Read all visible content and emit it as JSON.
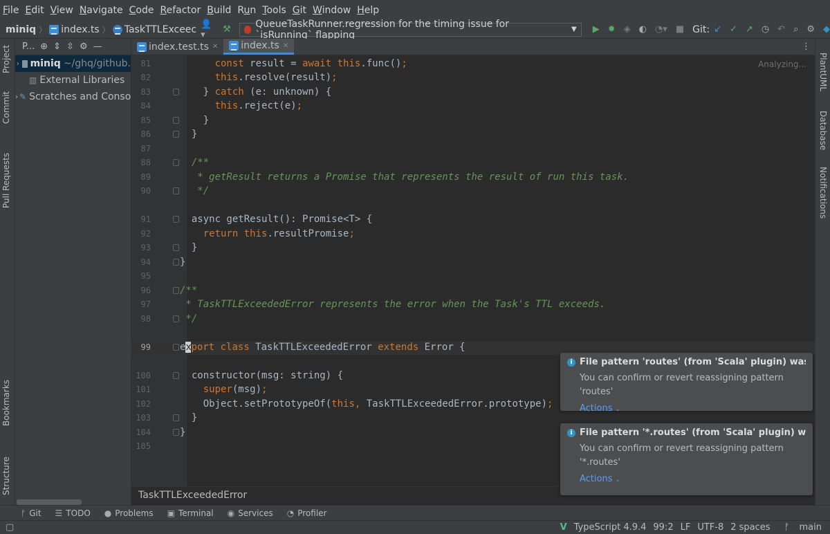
{
  "menu": [
    "File",
    "Edit",
    "View",
    "Navigate",
    "Code",
    "Refactor",
    "Build",
    "Run",
    "Tools",
    "Git",
    "Window",
    "Help"
  ],
  "menu_mnemonic_index": [
    0,
    0,
    0,
    0,
    0,
    0,
    0,
    1,
    0,
    0,
    0,
    0
  ],
  "breadcrumbs": [
    "miniq",
    "index.ts",
    "TaskTTLExceec"
  ],
  "run_config": "QueueTaskRunner.regression for the timing issue for `isRunning` flapping",
  "git_label": "Git:",
  "project_panel": {
    "title": "P...",
    "items": [
      {
        "label": "miniq",
        "path": "~/ghq/github."
      },
      {
        "label": "External Libraries"
      },
      {
        "label": "Scratches and Conso"
      }
    ]
  },
  "left_tabs": [
    "Project",
    "Commit",
    "Pull Requests",
    "Bookmarks",
    "Structure"
  ],
  "right_tabs": [
    "PlantUML",
    "Database",
    "Notifications"
  ],
  "editor_tabs": [
    {
      "label": "index.test.ts",
      "active": false
    },
    {
      "label": "index.ts",
      "active": true
    }
  ],
  "analyzing": "Analyzing...",
  "code_lines": [
    {
      "n": "81",
      "parts": [
        [
          "tx",
          "      "
        ],
        [
          "kw",
          "const "
        ],
        [
          "tx",
          "result = "
        ],
        [
          "kw",
          "await this"
        ],
        [
          "tx",
          ".func()"
        ],
        [
          "kw",
          ";"
        ]
      ]
    },
    {
      "n": "82",
      "parts": [
        [
          "tx",
          "      "
        ],
        [
          "kw",
          "this"
        ],
        [
          "tx",
          ".resolve(result)"
        ],
        [
          "kw",
          ";"
        ]
      ]
    },
    {
      "n": "83",
      "parts": [
        [
          "tx",
          "    } "
        ],
        [
          "kw",
          "catch "
        ],
        [
          "tx",
          "(e: unknown) {"
        ]
      ]
    },
    {
      "n": "84",
      "parts": [
        [
          "tx",
          "      "
        ],
        [
          "kw",
          "this"
        ],
        [
          "tx",
          ".reject(e)"
        ],
        [
          "kw",
          ";"
        ]
      ]
    },
    {
      "n": "85",
      "parts": [
        [
          "tx",
          "    }"
        ]
      ]
    },
    {
      "n": "86",
      "parts": [
        [
          "tx",
          "  }"
        ]
      ]
    },
    {
      "n": "87",
      "parts": []
    },
    {
      "n": "88",
      "parts": [
        [
          "cm",
          "  /**"
        ]
      ]
    },
    {
      "n": "89",
      "parts": [
        [
          "cm",
          "   * getResult returns a Promise that represents the result of run this task."
        ]
      ]
    },
    {
      "n": "90",
      "parts": [
        [
          "cm",
          "   */"
        ]
      ]
    },
    {
      "n": "",
      "parts": []
    },
    {
      "n": "91",
      "parts": [
        [
          "tx",
          "  async getResult(): Promise<T> {"
        ]
      ]
    },
    {
      "n": "92",
      "parts": [
        [
          "tx",
          "    "
        ],
        [
          "kw",
          "return this"
        ],
        [
          "tx",
          ".resultPromise"
        ],
        [
          "kw",
          ";"
        ]
      ]
    },
    {
      "n": "93",
      "parts": [
        [
          "tx",
          "  }"
        ]
      ]
    },
    {
      "n": "94",
      "parts": [
        [
          "tx",
          "}"
        ]
      ]
    },
    {
      "n": "95",
      "parts": []
    },
    {
      "n": "96",
      "parts": [
        [
          "cm",
          "/**"
        ]
      ]
    },
    {
      "n": "97",
      "parts": [
        [
          "cm",
          " * TaskTTLExceededError represents the error when the Task's TTL exceeds."
        ]
      ]
    },
    {
      "n": "98",
      "parts": [
        [
          "cm",
          " */"
        ]
      ]
    },
    {
      "n": "",
      "parts": []
    },
    {
      "n": "99",
      "parts": [
        [
          "tx",
          "e"
        ],
        [
          "cursor",
          "x"
        ],
        [
          "kw",
          "port class "
        ],
        [
          "tx",
          "TaskTTLExceededError "
        ],
        [
          "kw",
          "extends "
        ],
        [
          "tx",
          "Error {"
        ]
      ]
    },
    {
      "n": "",
      "parts": []
    },
    {
      "n": "100",
      "parts": [
        [
          "tx",
          "  constructor(msg: string) {"
        ]
      ]
    },
    {
      "n": "101",
      "parts": [
        [
          "tx",
          "    "
        ],
        [
          "kw",
          "super"
        ],
        [
          "tx",
          "(msg)"
        ],
        [
          "kw",
          ";"
        ]
      ]
    },
    {
      "n": "102",
      "parts": [
        [
          "tx",
          "    Object.setPrototypeOf("
        ],
        [
          "kw",
          "this, "
        ],
        [
          "tx",
          "TaskTTLExceededError.prototype)"
        ],
        [
          "kw",
          ";"
        ]
      ]
    },
    {
      "n": "103",
      "parts": [
        [
          "tx",
          "  }"
        ]
      ]
    },
    {
      "n": "104",
      "parts": [
        [
          "tx",
          "}"
        ]
      ]
    },
    {
      "n": "105",
      "parts": []
    }
  ],
  "editor_breadcrumb": "TaskTTLExceededError",
  "notifications": [
    {
      "title": "File pattern 'routes' (from 'Scala' plugin) was rе",
      "body": "You can confirm or revert reassigning pattern 'routes'",
      "actions": "Actions"
    },
    {
      "title": "File pattern '*.routes' (from 'Scala' plugin) was",
      "body": "You can confirm or revert reassigning pattern '*.routes'",
      "actions": "Actions"
    }
  ],
  "bottom_tools": [
    "Git",
    "TODO",
    "Problems",
    "Terminal",
    "Services",
    "Profiler"
  ],
  "status": {
    "language": "TypeScript 4.9.4",
    "position": "99:2",
    "line_sep": "LF",
    "encoding": "UTF-8",
    "indent": "2 spaces",
    "branch": "main"
  }
}
